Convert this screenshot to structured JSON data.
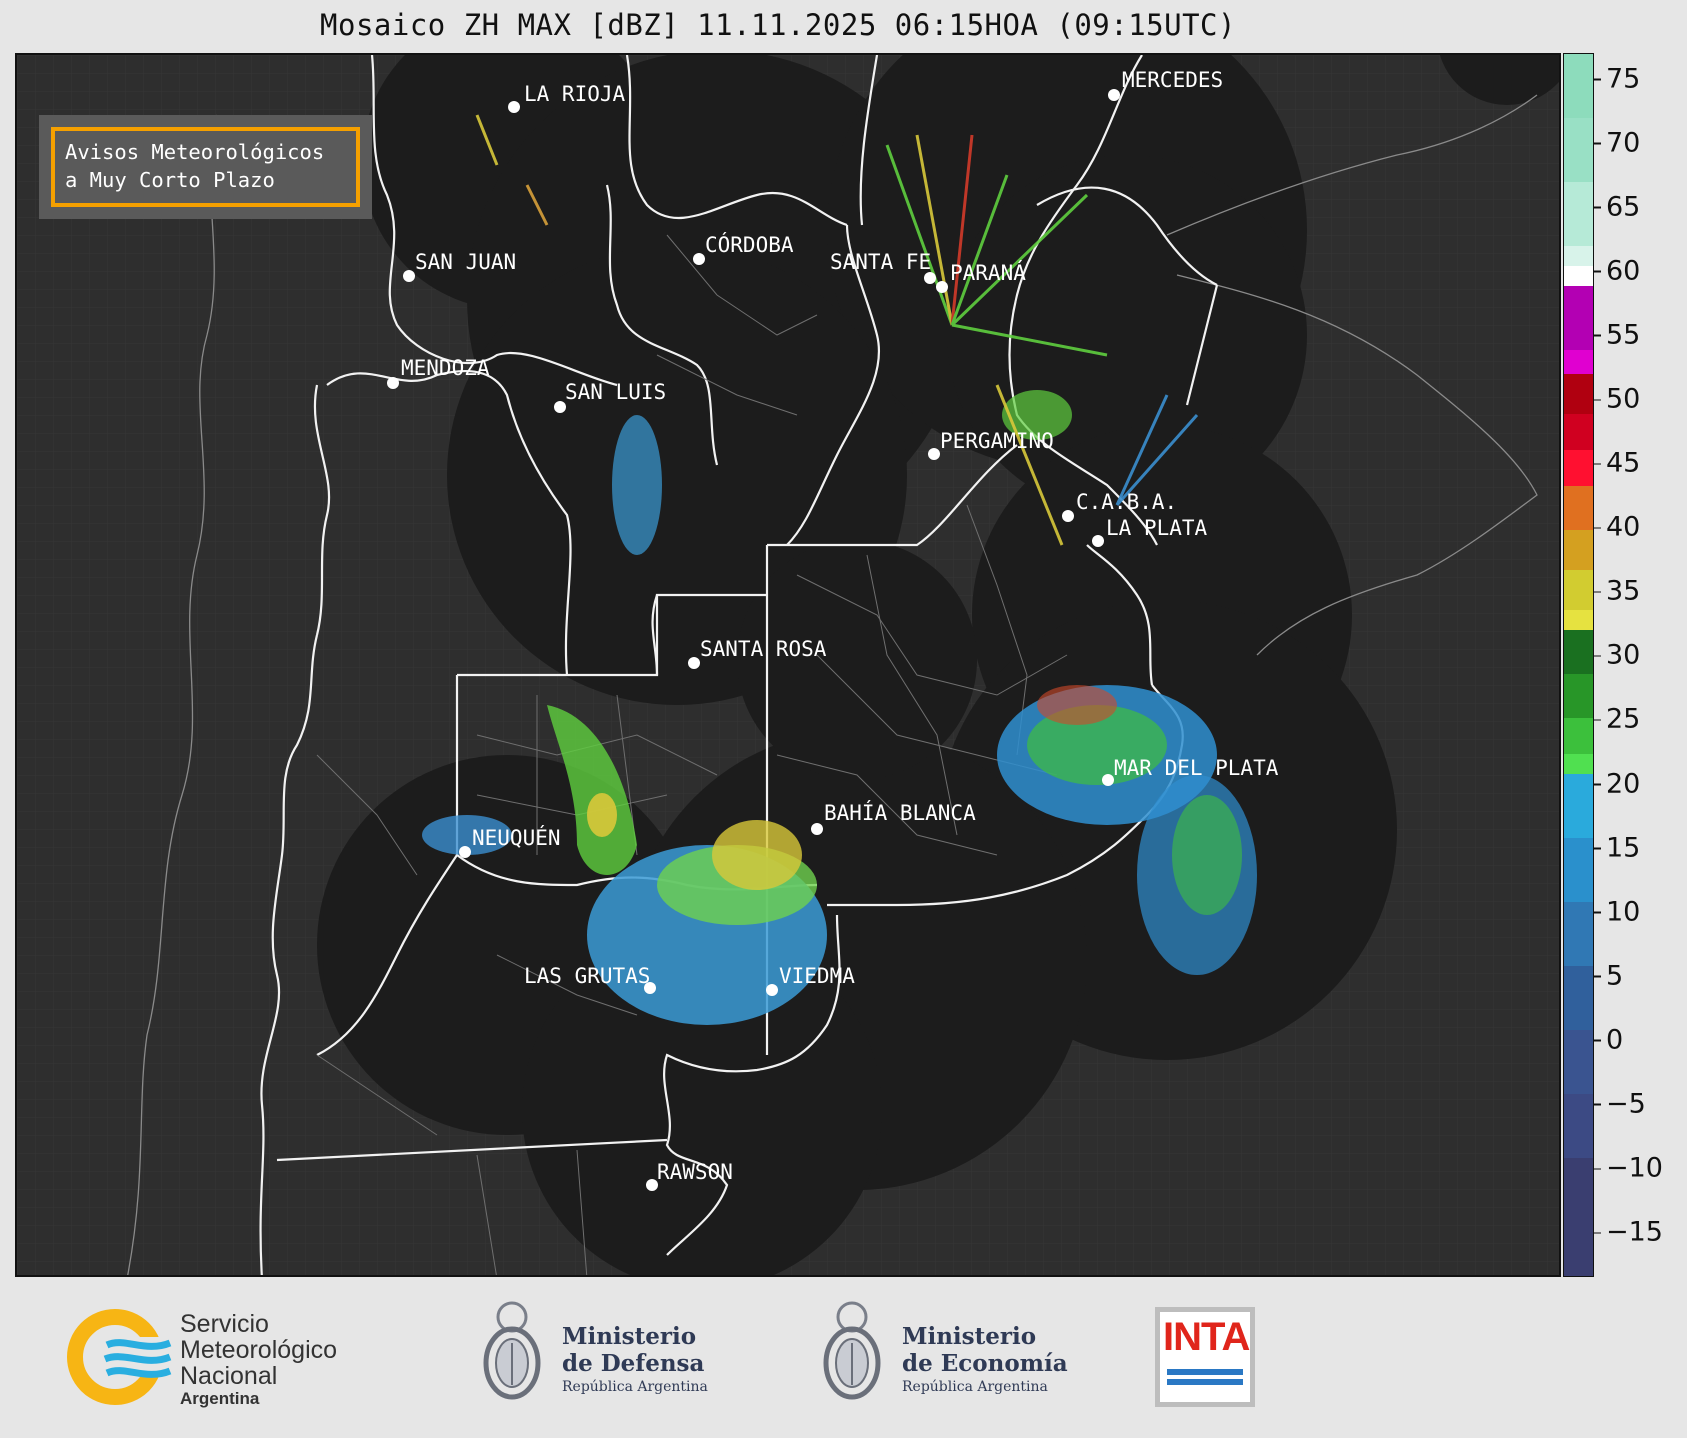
{
  "title": "Mosaico ZH MAX [dBZ] 11.11.2025 06:15HOA (09:15UTC)",
  "warning_box": {
    "text": "Avisos Meteorológicos\na Muy Corto Plazo"
  },
  "cities": [
    {
      "name": "LA RIOJA"
    },
    {
      "name": "MERCEDES"
    },
    {
      "name": "SAN JUAN"
    },
    {
      "name": "CÓRDOBA"
    },
    {
      "name": "SANTA FE"
    },
    {
      "name": "PARANÁ"
    },
    {
      "name": "MENDOZA"
    },
    {
      "name": "SAN LUIS"
    },
    {
      "name": "PERGAMINO"
    },
    {
      "name": "C.A.B.A."
    },
    {
      "name": "LA PLATA"
    },
    {
      "name": "SANTA ROSA"
    },
    {
      "name": "MAR DEL PLATA"
    },
    {
      "name": "BAHÍA BLANCA"
    },
    {
      "name": "NEUQUÉN"
    },
    {
      "name": "LAS GRUTAS"
    },
    {
      "name": "VIEDMA"
    },
    {
      "name": "RAWSON"
    }
  ],
  "colorbar": {
    "ticks": [
      "75",
      "70",
      "65",
      "60",
      "55",
      "50",
      "45",
      "40",
      "35",
      "30",
      "25",
      "20",
      "15",
      "10",
      "5",
      "0",
      "−5",
      "−10",
      "−15"
    ],
    "range": [
      -18.5,
      77
    ]
  },
  "logos": {
    "smn": {
      "lines": [
        "Servicio",
        "Meteorológico",
        "Nacional"
      ],
      "sub": "Argentina"
    },
    "defensa": {
      "lines": [
        "Ministerio",
        "de Defensa"
      ],
      "sub": "República Argentina"
    },
    "economia": {
      "lines": [
        "Ministerio",
        "de Economía"
      ],
      "sub": "República Argentina"
    },
    "inta": {
      "text": "INTA"
    }
  }
}
